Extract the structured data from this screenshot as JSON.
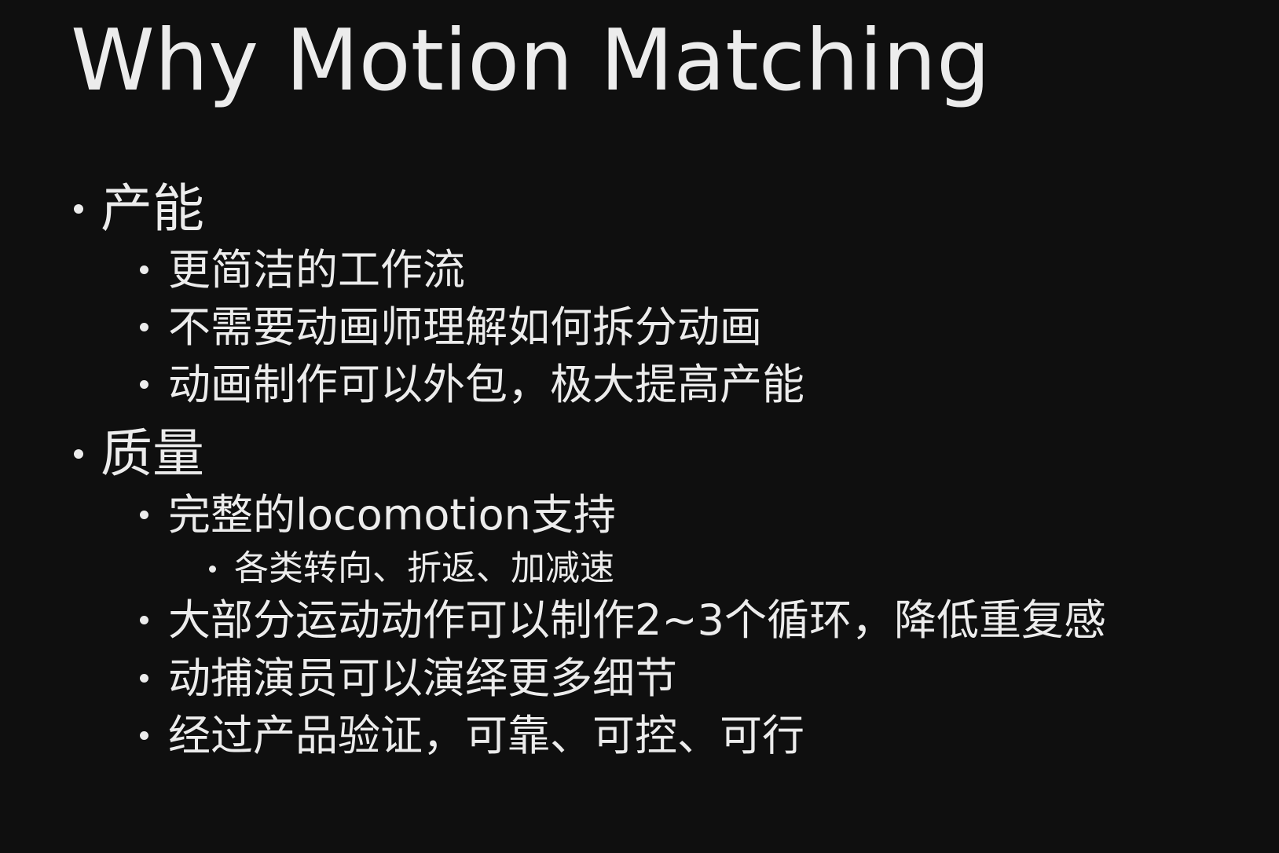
{
  "slide": {
    "title": "Why Motion Matching",
    "sections": [
      {
        "heading": "产能",
        "items": [
          "更简洁的工作流",
          "不需要动画师理解如何拆分动画",
          "动画制作可以外包，极大提高产能"
        ]
      },
      {
        "heading": "质量",
        "items": [
          "完整的locomotion支持",
          "各类转向、折返、加减速",
          "大部分运动动作可以制作2~3个循环，降低重复感",
          "动捕演员可以演绎更多细节",
          "经过产品验证，可靠、可控、可行"
        ]
      }
    ]
  },
  "colors": {
    "background": "#0f0f0f",
    "text": "#ececec"
  }
}
